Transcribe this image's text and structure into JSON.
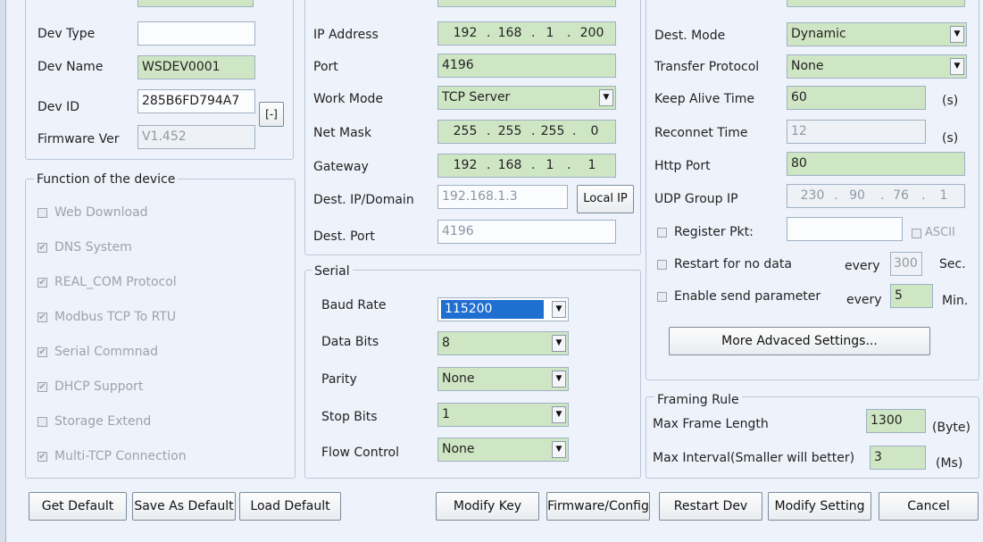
{
  "device": {
    "dev_type_label": "Dev Type",
    "dev_type_value": "",
    "dev_name_label": "Dev Name",
    "dev_name_value": "WSDEV0001",
    "dev_id_label": "Dev ID",
    "dev_id_value": "285B6FD794A7",
    "dev_id_button": "[-]",
    "firmware_label": "Firmware Ver",
    "firmware_value": "V1.452"
  },
  "functions": {
    "title": "Function of the device",
    "items": [
      {
        "label": "Web Download",
        "checked": false
      },
      {
        "label": "DNS System",
        "checked": true
      },
      {
        "label": "REAL_COM Protocol",
        "checked": true
      },
      {
        "label": "Modbus TCP To RTU",
        "checked": true
      },
      {
        "label": "Serial Commnad",
        "checked": true
      },
      {
        "label": "DHCP Support",
        "checked": true
      },
      {
        "label": "Storage Extend",
        "checked": false
      },
      {
        "label": "Multi-TCP Connection",
        "checked": true
      }
    ]
  },
  "network": {
    "ip_label": "IP Address",
    "ip": [
      "192",
      "168",
      "1",
      "200"
    ],
    "port_label": "Port",
    "port_value": "4196",
    "work_mode_label": "Work Mode",
    "work_mode_value": "TCP Server",
    "netmask_label": "Net Mask",
    "netmask": [
      "255",
      "255",
      "255",
      "0"
    ],
    "gateway_label": "Gateway",
    "gateway": [
      "192",
      "168",
      "1",
      "1"
    ],
    "dest_ip_label": "Dest. IP/Domain",
    "dest_ip_value": "192.168.1.3",
    "local_ip_button": "Local IP",
    "dest_port_label": "Dest. Port",
    "dest_port_value": "4196"
  },
  "serial": {
    "title": "Serial",
    "baud_label": "Baud Rate",
    "baud_value": "115200",
    "data_bits_label": "Data Bits",
    "data_bits_value": "8",
    "parity_label": "Parity",
    "parity_value": "None",
    "stop_bits_label": "Stop Bits",
    "stop_bits_value": "1",
    "flow_label": "Flow Control",
    "flow_value": "None"
  },
  "advanced": {
    "dest_mode_label": "Dest. Mode",
    "dest_mode_value": "Dynamic",
    "transfer_label": "Transfer Protocol",
    "transfer_value": "None",
    "keepalive_label": "Keep Alive Time",
    "keepalive_value": "60",
    "keepalive_unit": "(s)",
    "reconnect_label": "Reconnet Time",
    "reconnect_value": "12",
    "reconnect_unit": "(s)",
    "http_label": "Http Port",
    "http_value": "80",
    "udp_label": "UDP Group IP",
    "udp": [
      "230",
      "90",
      "76",
      "1"
    ],
    "register_label": "Register Pkt:",
    "register_value": "",
    "ascii_label": "ASCII",
    "restart_label": "Restart for no data",
    "restart_every": "every",
    "restart_value": "300",
    "restart_unit": "Sec.",
    "enable_label": "Enable send parameter",
    "enable_every": "every",
    "enable_value": "5",
    "enable_unit": "Min.",
    "more_button": "More Advaced Settings..."
  },
  "framing": {
    "title": "Framing Rule",
    "max_len_label": "Max Frame Length",
    "max_len_value": "1300",
    "max_len_unit": "(Byte)",
    "max_int_label": "Max Interval(Smaller will better)",
    "max_int_value": "3",
    "max_int_unit": "(Ms)"
  },
  "buttons": {
    "get_default": "Get Default",
    "save_default": "Save As Default",
    "load_default": "Load Default",
    "modify_key": "Modify Key",
    "firmware": "Firmware/Config",
    "restart": "Restart Dev",
    "modify_setting": "Modify Setting",
    "cancel": "Cancel"
  },
  "colors": {
    "field_green": "#cfe6c4",
    "selection_blue": "#1f6fd1",
    "background": "#eef3fb"
  }
}
